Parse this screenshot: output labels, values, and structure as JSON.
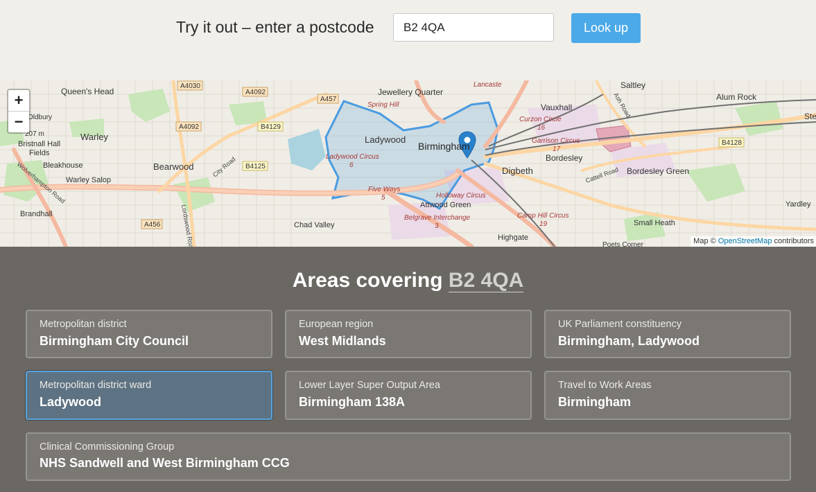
{
  "header": {
    "prompt": "Try it out – enter a postcode",
    "postcode_value": "B2 4QA",
    "lookup_label": "Look up"
  },
  "map": {
    "zoom_in": "+",
    "zoom_out": "−",
    "attribution_prefix": "Map ©",
    "attribution_link": "OpenStreetMap",
    "attribution_suffix": "contributors",
    "place_labels": {
      "queens_head": "Queen's Head",
      "jewellery_quarter": "Jewellery Quarter",
      "saltley": "Saltley",
      "alum_rock": "Alum Rock",
      "vauxhall": "Vauxhall",
      "warley": "Warley",
      "ladywood": "Ladywood",
      "birmingham": "Birmingham",
      "bordesley": "Bordesley",
      "bristnall_hall_fields_1": "Bristnall Hall",
      "bristnall_hall_fields_2": "Fields",
      "bleakhouse": "Bleakhouse",
      "bearwood": "Bearwood",
      "digbeth": "Digbeth",
      "bordesley_green": "Bordesley Green",
      "warley_salop": "Warley Salop",
      "attwood_green": "Attwood Green",
      "yardley": "Yardley",
      "brandhall": "Brandhall",
      "chad_valley": "Chad Valley",
      "small_heath": "Small Heath",
      "highgate": "Highgate",
      "poets_corner": "Poets Corner",
      "oldbury_partial": "Oldbury",
      "altitude": "207 m",
      "lancaster": "Lancaste",
      "ste": "Ste"
    },
    "road_labels": {
      "a4030": "A4030",
      "a4092": "A4092",
      "a4092b": "A4092",
      "a457": "A457",
      "b4129": "B4129",
      "b4125": "B4125",
      "a456": "A456",
      "b4128": "B4128",
      "wolverhampton_road": "Wolverhampton Road",
      "city_road": "City Road",
      "lordswood_road": "Lordswood Road",
      "cattell_road": "Cattell Road",
      "ash_road": "Ash Road"
    },
    "junction_labels": {
      "spring_hill": "Spring Hill",
      "ladywood_circus": "Ladywood Circus",
      "ladywood_circus_num": "6",
      "five_ways": "Five Ways",
      "five_ways_num": "5",
      "curzon_circle": "Curzon Circle",
      "curzon_num": "16",
      "garrison_circus": "Garrison Circus",
      "garrison_num": "17",
      "holloway_circus": "Holloway Circus",
      "belgrave_interchange": "Belgrave Interchange",
      "belgrave_num": "3",
      "camp_hill_circus": "Camp Hill Circus",
      "camp_hill_num": "19",
      "lancaster_top": "Lancaste"
    }
  },
  "results": {
    "heading_prefix": "Areas covering",
    "heading_postcode": "B2 4QA",
    "cards": [
      {
        "type": "Metropolitan district",
        "name": "Birmingham City Council"
      },
      {
        "type": "European region",
        "name": "West Midlands"
      },
      {
        "type": "UK Parliament constituency",
        "name": "Birmingham, Ladywood"
      },
      {
        "type": "Metropolitan district ward",
        "name": "Ladywood"
      },
      {
        "type": "Lower Layer Super Output Area",
        "name": "Birmingham 138A"
      },
      {
        "type": "Travel to Work Areas",
        "name": "Birmingham"
      },
      {
        "type": "Clinical Commissioning Group",
        "name": "NHS Sandwell and West Birmingham CCG"
      }
    ]
  },
  "colors": {
    "topbar_bg": "#f0efea",
    "lookup_button": "#4ba9e8",
    "results_bg": "#6b6863",
    "card_bg": "#7b7874",
    "active_card_bg": "#5d7282",
    "boundary_stroke": "#4a9be0",
    "map_pin": "#2a81cb"
  }
}
